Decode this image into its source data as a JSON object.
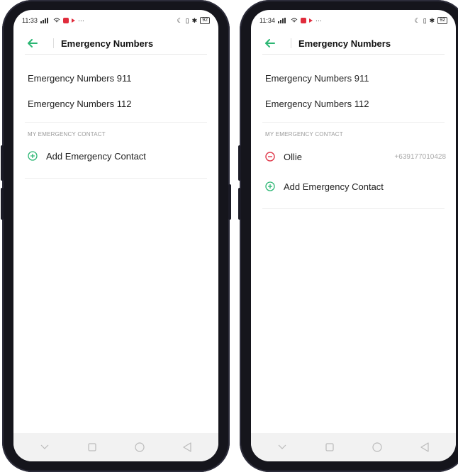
{
  "colors": {
    "accent": "#2bb673",
    "remove": "#e0394b",
    "frame": "#15151c"
  },
  "left": {
    "status": {
      "time": "11:33",
      "battery": "92"
    },
    "header": {
      "title": "Emergency Numbers",
      "back_icon": "arrow-left-icon"
    },
    "numbers": [
      "Emergency Numbers 911",
      "Emergency Numbers 112"
    ],
    "section_label": "MY EMERGENCY CONTACT",
    "add_label": "Add Emergency Contact"
  },
  "right": {
    "status": {
      "time": "11:34",
      "battery": "92"
    },
    "header": {
      "title": "Emergency Numbers",
      "back_icon": "arrow-left-icon"
    },
    "numbers": [
      "Emergency Numbers 911",
      "Emergency Numbers 112"
    ],
    "section_label": "MY EMERGENCY CONTACT",
    "contact": {
      "name": "Ollie",
      "phone": "+639177010428"
    },
    "add_label": "Add Emergency Contact"
  },
  "navbar": [
    "chevron-down-icon",
    "square-icon",
    "circle-icon",
    "triangle-back-icon"
  ]
}
